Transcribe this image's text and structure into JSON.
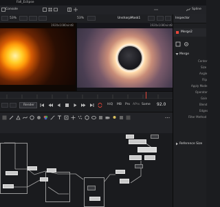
{
  "titlebar": {
    "project_tab": "Fall_Eclipse"
  },
  "menubar": {
    "console_label": "Console",
    "spline_label": "Spline"
  },
  "viewer": {
    "left_zoom": "53%",
    "right_zoom": "53%",
    "right_node": "UnsharpMask1",
    "left_resolution": "1920x1080xint8",
    "right_resolution": "1920x1080xint8"
  },
  "transport": {
    "render_label": "Render",
    "hiq_label": "HiQ",
    "mb_label": "MB",
    "prx_label": "Prx",
    "aprx_label": "APrx",
    "some_label": "Some",
    "current_frame": "92.0"
  },
  "inspector": {
    "title": "Inspector",
    "node_name": "Merge2",
    "section_merge": "Merge",
    "section_reference": "Reference Size",
    "fields": [
      "Center",
      "Size",
      "Angle",
      "Flip",
      "Apply Mode",
      "Operator",
      "Gain",
      "Blend",
      "Edges",
      "Filter Method"
    ]
  },
  "colors": {
    "accent_red": "#e8463a",
    "panel_bg": "#1e1f22",
    "node_bg": "#c9c9c9"
  }
}
